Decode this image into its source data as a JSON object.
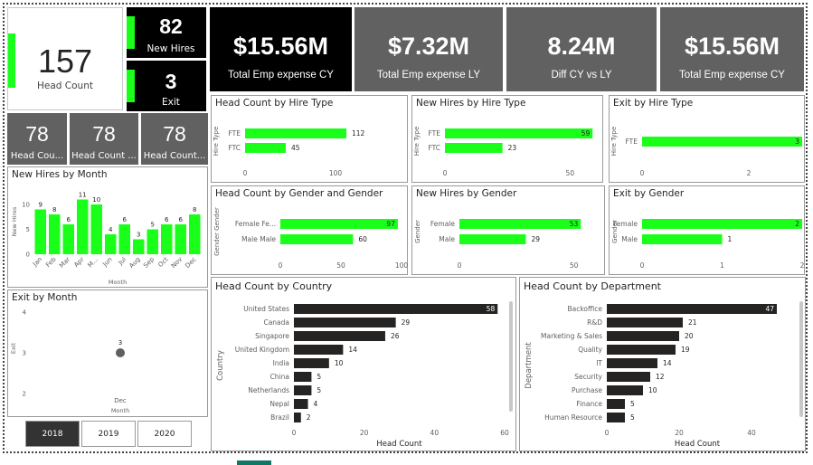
{
  "head_count": {
    "value": "157",
    "label": "Head Count"
  },
  "new_hires_card": {
    "value": "82",
    "label": "New Hires"
  },
  "exit_card": {
    "value": "3",
    "label": "Exit"
  },
  "kpis": [
    {
      "value": "$15.56M",
      "label": "Total Emp expense CY"
    },
    {
      "value": "$7.32M",
      "label": "Total Emp expense LY"
    },
    {
      "value": "8.24M",
      "label": "Diff CY vs LY"
    },
    {
      "value": "$15.56M",
      "label": "Total Emp expense CY"
    }
  ],
  "small_cards": [
    {
      "value": "78",
      "label": "Head Cou..."
    },
    {
      "value": "78",
      "label": "Head Count ..."
    },
    {
      "value": "78",
      "label": "Head Count..."
    }
  ],
  "year_buttons": [
    "2018",
    "2019",
    "2020"
  ],
  "colors": {
    "accent": "#1aff1a",
    "dark_bar": "#252423",
    "kpi_dark": "#000000",
    "kpi_grey": "#616161"
  },
  "chart_data": [
    {
      "id": "new-hires-by-month",
      "type": "bar",
      "title": "New Hires by Month",
      "xlabel": "Month",
      "ylabel": "New Hires",
      "categories": [
        "Jan",
        "Feb",
        "Mar",
        "Apr",
        "M...",
        "Jun",
        "Jul",
        "Aug",
        "Sep",
        "Oct",
        "Nov",
        "Dec"
      ],
      "values": [
        9,
        8,
        6,
        11,
        10,
        4,
        6,
        3,
        5,
        6,
        6,
        8
      ],
      "yticks": [
        "0",
        "5",
        "10"
      ],
      "ylim": [
        0,
        12
      ]
    },
    {
      "id": "exit-by-month",
      "type": "scatter",
      "title": "Exit by Month",
      "xlabel": "Month",
      "ylabel": "Exit",
      "categories": [
        "Dec"
      ],
      "values": [
        3
      ],
      "yticks": [
        "2",
        "3",
        "4"
      ],
      "ylim": [
        2,
        4
      ]
    },
    {
      "id": "head-count-by-hire-type",
      "type": "bar",
      "orientation": "horizontal",
      "title": "Head Count by Hire Type",
      "ylabel": "Hire Type",
      "categories": [
        "FTE",
        "FTC"
      ],
      "values": [
        112,
        45
      ],
      "xticks": [
        "0",
        "100"
      ],
      "xlim": [
        0,
        150
      ]
    },
    {
      "id": "new-hires-by-hire-type",
      "type": "bar",
      "orientation": "horizontal",
      "title": "New Hires by Hire Type",
      "ylabel": "Hire Type",
      "categories": [
        "FTE",
        "FTC"
      ],
      "values": [
        59,
        23
      ],
      "xticks": [
        "0",
        "50"
      ],
      "xlim": [
        0,
        60
      ]
    },
    {
      "id": "exit-by-hire-type",
      "type": "bar",
      "orientation": "horizontal",
      "title": "Exit by Hire Type",
      "ylabel": "Hire Type",
      "categories": [
        "FTE"
      ],
      "values": [
        3
      ],
      "xticks": [
        "0",
        "2"
      ],
      "xlim": [
        0,
        3
      ]
    },
    {
      "id": "head-count-by-gender",
      "type": "bar",
      "orientation": "horizontal",
      "title": "Head Count by Gender and Gender",
      "ylabel": "Gender Gender",
      "categories": [
        "Female Fe...",
        "Male Male"
      ],
      "values": [
        97,
        60
      ],
      "xticks": [
        "0",
        "50",
        "100"
      ],
      "xlim": [
        0,
        100
      ]
    },
    {
      "id": "new-hires-by-gender",
      "type": "bar",
      "orientation": "horizontal",
      "title": "New Hires by Gender",
      "ylabel": "Gender",
      "categories": [
        "Female",
        "Male"
      ],
      "values": [
        53,
        29
      ],
      "xticks": [
        "0",
        "50"
      ],
      "xlim": [
        0,
        60
      ]
    },
    {
      "id": "exit-by-gender",
      "type": "bar",
      "orientation": "horizontal",
      "title": "Exit by Gender",
      "ylabel": "Gender",
      "categories": [
        "Female",
        "Male"
      ],
      "values": [
        2,
        1
      ],
      "xticks": [
        "0",
        "1",
        "2"
      ],
      "xlim": [
        0,
        2
      ]
    },
    {
      "id": "head-count-by-country",
      "type": "bar",
      "orientation": "horizontal",
      "title": "Head Count by Country",
      "xlabel": "Head Count",
      "ylabel": "Country",
      "categories": [
        "United States",
        "Canada",
        "Singapore",
        "United Kingdom",
        "India",
        "China",
        "Netherlands",
        "Nepal",
        "Brazil"
      ],
      "values": [
        58,
        29,
        26,
        14,
        10,
        5,
        5,
        4,
        2
      ],
      "xticks": [
        "0",
        "20",
        "40",
        "60"
      ],
      "xlim": [
        0,
        60
      ]
    },
    {
      "id": "head-count-by-department",
      "type": "bar",
      "orientation": "horizontal",
      "title": "Head Count by Department",
      "xlabel": "Head Count",
      "ylabel": "Department",
      "categories": [
        "Backoffice",
        "R&D",
        "Marketing & Sales",
        "Quality",
        "IT",
        "Security",
        "Purchase",
        "Finance",
        "Human Resource"
      ],
      "values": [
        47,
        21,
        20,
        19,
        14,
        12,
        10,
        5,
        5
      ],
      "xticks": [
        "0",
        "20",
        "40"
      ],
      "xlim": [
        0,
        50
      ]
    }
  ]
}
